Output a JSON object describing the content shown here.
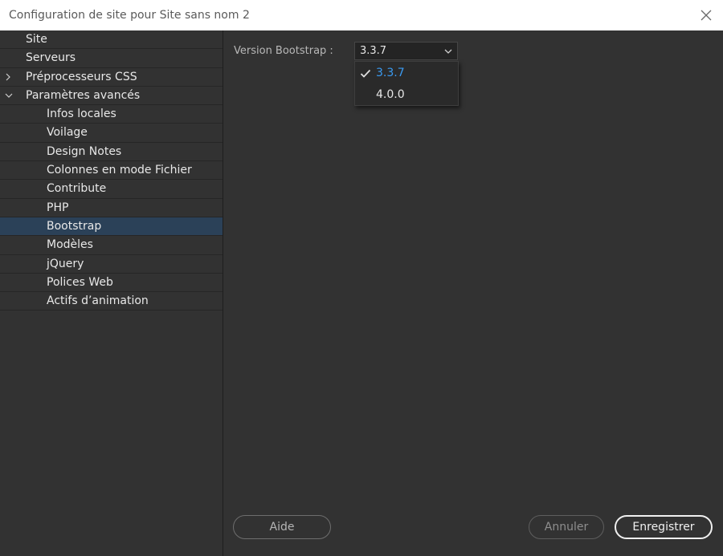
{
  "window": {
    "title": "Configuration de site pour Site sans nom 2",
    "close_icon": "close-icon"
  },
  "sidebar": {
    "items": [
      {
        "label": "Site",
        "level": 0
      },
      {
        "label": "Serveurs",
        "level": 0
      },
      {
        "label": "Préprocesseurs CSS",
        "level": 0,
        "expander": "collapsed"
      },
      {
        "label": "Paramètres avancés",
        "level": 0,
        "expander": "expanded"
      },
      {
        "label": "Infos locales",
        "level": 1
      },
      {
        "label": "Voilage",
        "level": 1
      },
      {
        "label": "Design Notes",
        "level": 1
      },
      {
        "label": "Colonnes en mode Fichier",
        "level": 1
      },
      {
        "label": "Contribute",
        "level": 1
      },
      {
        "label": "PHP",
        "level": 1
      },
      {
        "label": "Bootstrap",
        "level": 1,
        "selected": true
      },
      {
        "label": "Modèles",
        "level": 1
      },
      {
        "label": "jQuery",
        "level": 1
      },
      {
        "label": "Polices Web",
        "level": 1
      },
      {
        "label": "Actifs d’animation",
        "level": 1
      }
    ]
  },
  "main": {
    "version_label": "Version Bootstrap :",
    "version_value": "3.3.7",
    "options": [
      {
        "label": "3.3.7",
        "checked": true
      },
      {
        "label": "4.0.0",
        "checked": false
      }
    ]
  },
  "buttons": {
    "help": "Aide",
    "cancel": "Annuler",
    "save": "Enregistrer"
  },
  "colors": {
    "selected_row": "#2b4158",
    "accent": "#3a9bf2",
    "background": "#323232"
  }
}
